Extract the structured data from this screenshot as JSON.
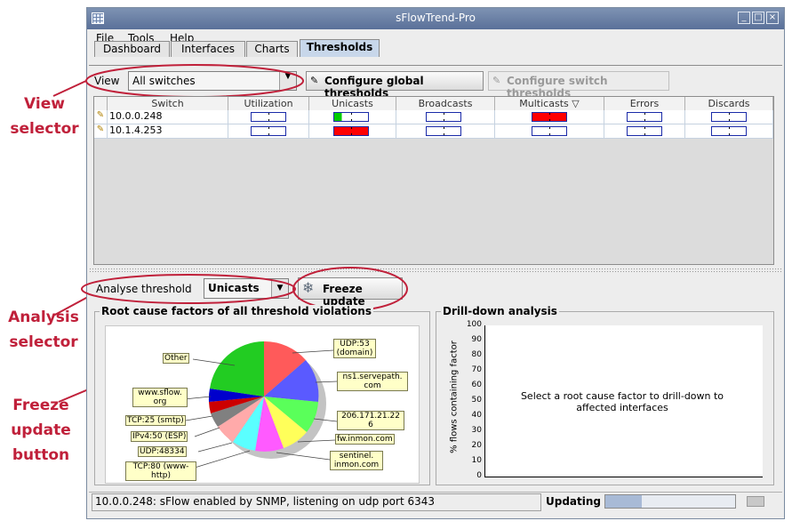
{
  "callouts": {
    "view_selector": "View\nselector",
    "analysis_selector": "Analysis\nselector",
    "freeze_button": "Freeze\nupdate\nbutton"
  },
  "window": {
    "title": "sFlowTrend-Pro",
    "menu": [
      "File",
      "Tools",
      "Help"
    ],
    "tabs": [
      "Dashboard",
      "Interfaces",
      "Charts",
      "Thresholds"
    ],
    "active_tab": "Thresholds"
  },
  "toolbar": {
    "view_label": "View",
    "view_value": "All switches",
    "configure_global": "Configure global thresholds",
    "configure_switch": "Configure switch thresholds"
  },
  "table": {
    "columns": [
      "Switch",
      "Utilization",
      "Unicasts",
      "Broadcasts",
      "Multicasts ▽",
      "Errors",
      "Discards"
    ],
    "rows": [
      {
        "switch": "10.0.0.248",
        "unicasts": "green",
        "multicasts": "red"
      },
      {
        "switch": "10.1.4.253",
        "unicasts": "red",
        "multicasts": "blue"
      }
    ]
  },
  "analysis": {
    "label": "Analyse threshold",
    "value": "Unicasts",
    "freeze": "Freeze update"
  },
  "root_cause": {
    "title": "Root cause factors of all threshold violations",
    "labels": [
      "Other",
      "www.sflow.\norg",
      "TCP:25 (smtp)",
      "IPv4:50 (ESP)",
      "UDP:48334",
      "TCP:80 (www-\nhttp)",
      "UDP:53\n(domain)",
      "ns1.servepath.\ncom",
      "206.171.21.22\n6",
      "fw.inmon.com",
      "sentinel.\ninmon.com"
    ]
  },
  "drilldown": {
    "title": "Drill-down analysis",
    "ylabel": "% flows containing factor",
    "yticks": [
      "100",
      "90",
      "80",
      "70",
      "60",
      "50",
      "40",
      "30",
      "20",
      "10",
      "0"
    ],
    "message": "Select a root cause factor to drill-down to\naffected interfaces"
  },
  "statusbar": {
    "message": "10.0.0.248: sFlow enabled by SNMP, listening on udp port 6343",
    "updating": "Updating",
    "progress": 0.28
  },
  "colors": {
    "annotation": "#c0203a",
    "gauge_red": "#ff0000",
    "gauge_green": "#00cc00"
  }
}
